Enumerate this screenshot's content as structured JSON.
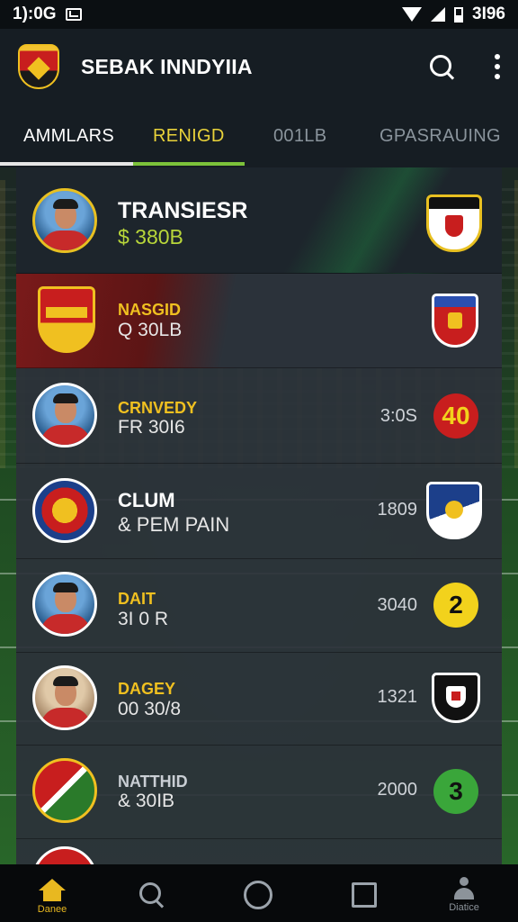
{
  "status_bar": {
    "time": "1):0G",
    "right_text": "3I96"
  },
  "app": {
    "title": "SEBAK INNDYIIA"
  },
  "tabs": [
    {
      "label": "AMMLARS",
      "state": "active"
    },
    {
      "label": "RENIGD",
      "state": "highlighted"
    },
    {
      "label": "001LB",
      "state": "inactive"
    },
    {
      "label": "GPASRAUING",
      "state": "inactive"
    }
  ],
  "rows": [
    {
      "name": "TRANSIESR",
      "sub": "$ 380B",
      "stat": "",
      "badge": ""
    },
    {
      "name": "NASGID",
      "sub": "Q 30LB",
      "stat": "",
      "badge": ""
    },
    {
      "name": "CRNVEDY",
      "sub": "FR 30I6",
      "stat": "3:0S",
      "badge": "40"
    },
    {
      "name": "CLUM",
      "sub": "& PEM PAIN",
      "stat": "1809",
      "badge": ""
    },
    {
      "name": "DAIT",
      "sub": "3I 0 R",
      "stat": "3040",
      "badge": "2"
    },
    {
      "name": "DAGEY",
      "sub": "00 30/8",
      "stat": "1321",
      "badge": ""
    },
    {
      "name": "NATTHID",
      "sub": "& 30IB",
      "stat": "2000",
      "badge": "3"
    }
  ],
  "colors": {
    "accent_green": "#7cc23a",
    "accent_gold": "#e8c021",
    "badge_red": "#c81e1e",
    "badge_yellow": "#f2d21c",
    "badge_green": "#3aa63a"
  },
  "bottom_nav": {
    "home_label": "Danee",
    "profile_label": "Diatice"
  }
}
